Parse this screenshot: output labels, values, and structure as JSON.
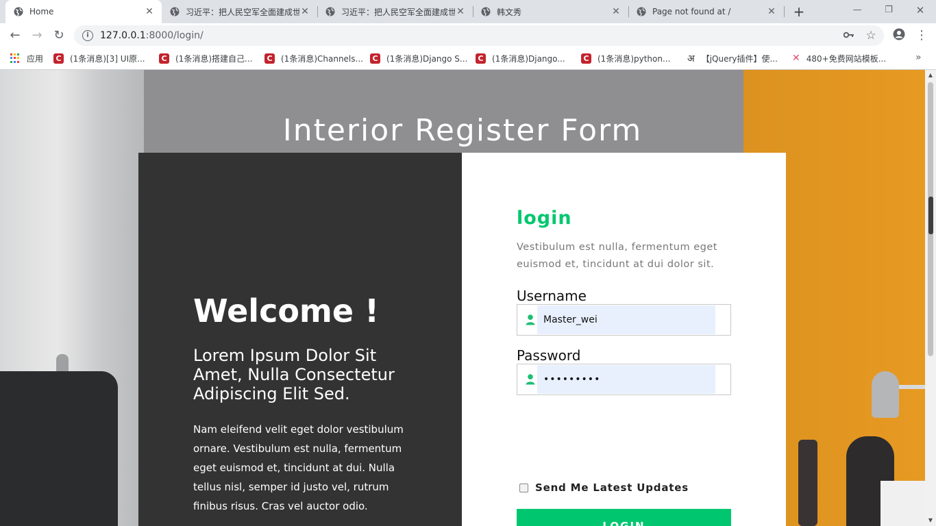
{
  "browser": {
    "tabs": [
      {
        "title": "Home",
        "active": true
      },
      {
        "title": "习近平：把人民空军全面建成世界一流空军",
        "active": false
      },
      {
        "title": "习近平：把人民空军全面建成世界一流空军",
        "active": false
      },
      {
        "title": "韩文秀",
        "active": false
      },
      {
        "title": "Page not found at /",
        "active": false
      }
    ],
    "new_tab": "+",
    "close": "✕",
    "url_host": "127.0.0.1",
    "url_path": ":8000/login/",
    "bookmarks": [
      {
        "label": "应用",
        "icon": "apps-icon"
      },
      {
        "label": "(1条消息)[3] UI原...",
        "icon": "csdn-icon"
      },
      {
        "label": "(1条消息)搭建自己...",
        "icon": "csdn-icon"
      },
      {
        "label": "(1条消息)Channels...",
        "icon": "csdn-icon"
      },
      {
        "label": "(1条消息)Django S...",
        "icon": "csdn-icon"
      },
      {
        "label": "(1条消息)Django...",
        "icon": "csdn-icon"
      },
      {
        "label": "(1条消息)python...",
        "icon": "csdn-icon"
      },
      {
        "label": "【jQuery插件】使...",
        "icon": "jquery-icon"
      },
      {
        "label": "480+免费网站模板...",
        "icon": "template-icon"
      }
    ]
  },
  "page": {
    "title": "Interior Register Form",
    "welcome": {
      "heading": "Welcome !",
      "lead": "Lorem Ipsum Dolor Sit Amet, Nulla Consectetur Adipiscing Elit Sed.",
      "body": "Nam eleifend velit eget dolor vestibulum ornare. Vestibulum est nulla, fermentum eget euismod et, tincidunt at dui. Nulla tellus nisl, semper id justo vel, rutrum finibus risus. Cras vel auctor odio."
    },
    "login": {
      "title": "login",
      "description": "Vestibulum est nulla, fermentum eget euismod et, tincidunt at dui dolor sit.",
      "username_label": "Username",
      "username_value": "Master_wei",
      "password_label": "Password",
      "password_value": "•••••••••",
      "updates_label": "Send Me Latest Updates",
      "submit_label": "LOGIN"
    }
  },
  "colors": {
    "accent": "#00c76f",
    "left_panel": "#333333"
  }
}
